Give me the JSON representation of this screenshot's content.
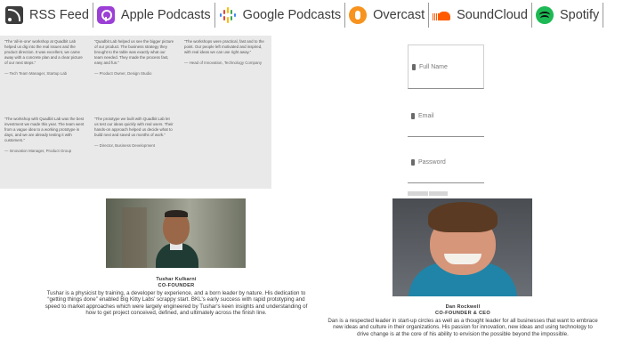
{
  "podcast_links": [
    {
      "label": "RSS Feed",
      "icon": "rss-icon"
    },
    {
      "label": "Apple Podcasts",
      "icon": "apple-podcasts-icon"
    },
    {
      "label": "Google Podcasts",
      "icon": "google-podcasts-icon"
    },
    {
      "label": "Overcast",
      "icon": "overcast-icon"
    },
    {
      "label": "SoundCloud",
      "icon": "soundcloud-icon"
    },
    {
      "label": "Spotify",
      "icon": "spotify-icon"
    }
  ],
  "testimonials": [
    {
      "quote": "“The 'all-in-one' workshop at Quadbit Lab helped us dig into the real issues and the product direction. It was excellent, we came away with a concrete plan and a clear picture of our next steps.”",
      "author": "— Tech Team Manager, Startup Lab"
    },
    {
      "quote": "“Quadbit Lab helped us see the bigger picture of our product. The business strategy they brought to the table was exactly what our team needed. They made the process fast, easy and fun.”",
      "author": "— Product Owner, Design Studio"
    },
    {
      "quote": "“The workshops were practical, fast and to the point. Our people left motivated and inspired, with real ideas we can use right away.”",
      "author": "— Head of Innovation, Technology Company"
    },
    {
      "quote": "“The workshop with Quadbit Lab was the best investment we made this year. The team went from a vague idea to a working prototype in days, and we are already testing it with customers.”",
      "author": "— Innovation Manager, Product Group"
    },
    {
      "quote": "“The prototype we built with Quadbit Lab let us test our ideas quickly with real users. Their hands-on approach helped us decide what to build next and saved us months of work.”",
      "author": "— Director, Business Development"
    }
  ],
  "form": {
    "full_name_placeholder": "Full Name",
    "email_placeholder": "Email",
    "password_placeholder": "Password"
  },
  "team": [
    {
      "name": "Tushar Kulkarni",
      "role": "CO-FOUNDER",
      "bio": "Tushar is a physicist by training, a developer by experience, and a born leader by nature. His dedication to “getting things done” enabled Big Kitty Labs' scrappy start. BKL's early success with rapid prototyping and speed to market approaches which were largely engineered by Tushar's keen insights and understanding of how to get project conceived, defined, and ultimately across the finish line."
    },
    {
      "name": "Dan Rockwell",
      "role": "CO-FOUNDER & CEO",
      "bio": "Dan is a respected leader in start-up circles as well as a thought leader for all businesses that want to embrace new ideas and culture in their organizations. His passion for innovation, new ideas and using technology to drive change is at the core of his ability to envision the possible beyond the impossible."
    }
  ],
  "colors": {
    "apple": "#9b3fd6",
    "overcast": "#f7931e",
    "soundcloud": "#ff5a00",
    "spotify": "#1db954"
  }
}
